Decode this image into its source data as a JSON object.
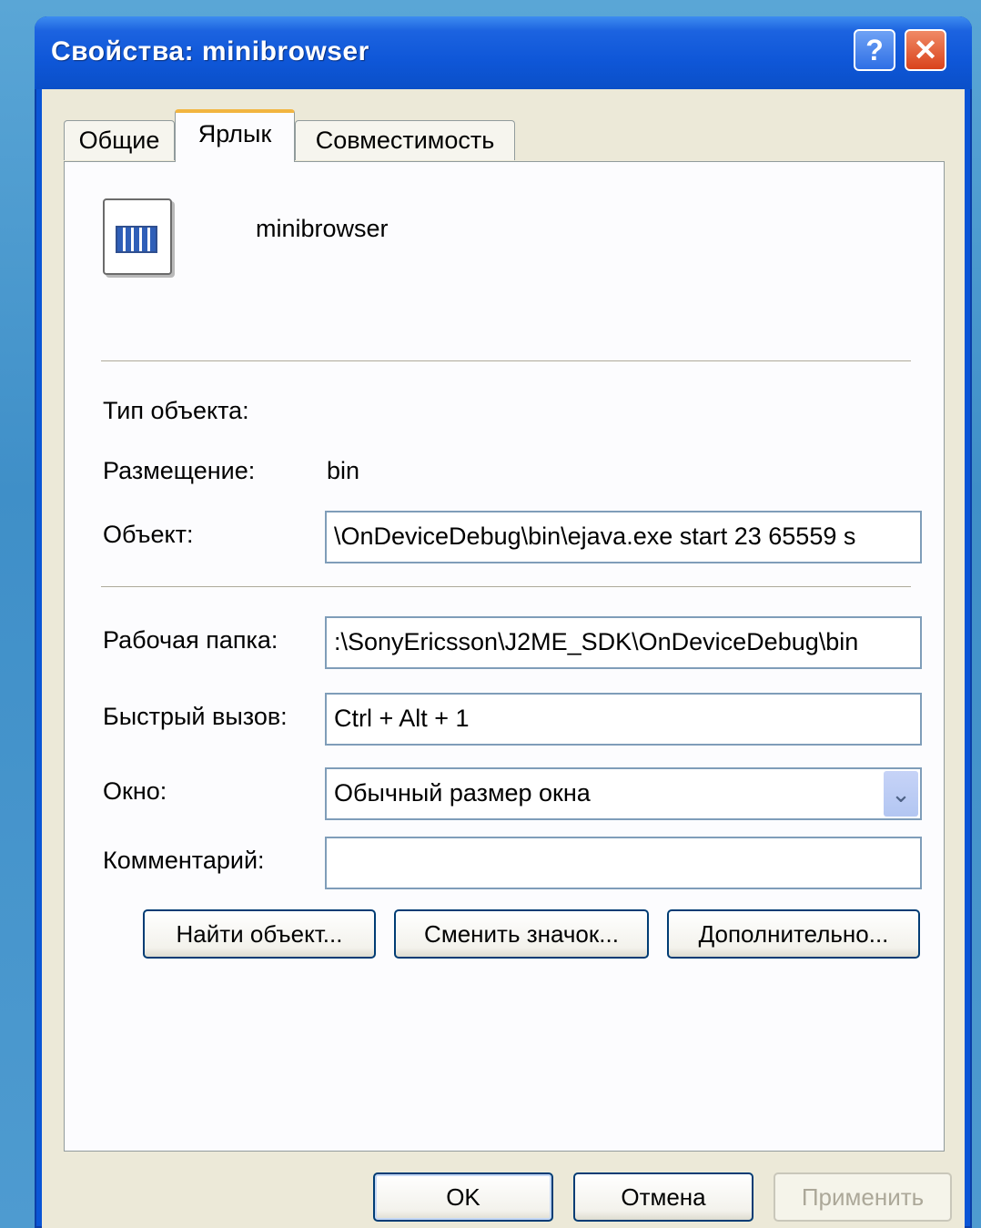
{
  "window": {
    "title": "Свойства: minibrowser",
    "help_glyph": "?",
    "close_glyph": "✕"
  },
  "tabs": [
    {
      "label": "Общие",
      "active": false
    },
    {
      "label": "Ярлык",
      "active": true
    },
    {
      "label": "Совместимость",
      "active": false
    }
  ],
  "shortcut": {
    "name": "minibrowser",
    "icon": "application-window-icon",
    "object_type_label": "Тип объекта:",
    "object_type_value": "",
    "location_label": "Размещение:",
    "location_value": "bin",
    "target_label": "Объект:",
    "target_value": "\\OnDeviceDebug\\bin\\ejava.exe start 23 65559 s",
    "workdir_label": "Рабочая папка:",
    "workdir_value": ":\\SonyEricsson\\J2ME_SDK\\OnDeviceDebug\\bin",
    "hotkey_label": "Быстрый вызов:",
    "hotkey_value": "Ctrl + Alt + 1",
    "window_label": "Окно:",
    "window_value": "Обычный размер окна",
    "comment_label": "Комментарий:",
    "comment_value": ""
  },
  "actions": {
    "find_target": "Найти объект...",
    "change_icon": "Сменить значок...",
    "advanced": "Дополнительно..."
  },
  "footer": {
    "ok": "OK",
    "cancel": "Отмена",
    "apply": "Применить"
  }
}
